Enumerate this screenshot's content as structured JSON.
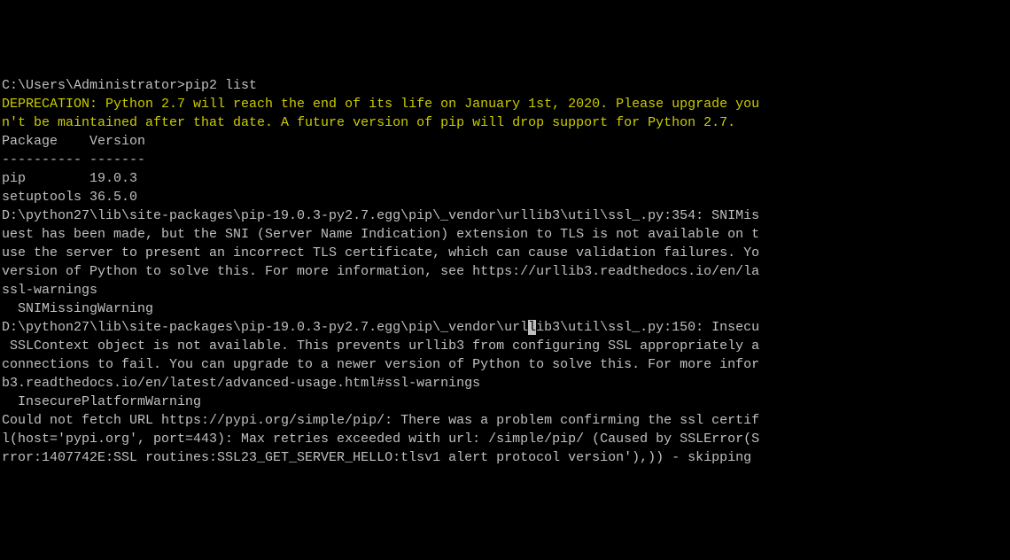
{
  "terminal": {
    "prompt": "C:\\Users\\Administrator>",
    "command": "pip2 list",
    "deprecation_line1": "DEPRECATION: Python 2.7 will reach the end of its life on January 1st, 2020. Please upgrade you",
    "deprecation_line2": "n't be maintained after that date. A future version of pip will drop support for Python 2.7.",
    "header": "Package    Version",
    "separator": "---------- -------",
    "pkg1": "pip        19.0.3",
    "pkg2": "setuptools 36.5.0",
    "warn1_line1": "D:\\python27\\lib\\site-packages\\pip-19.0.3-py2.7.egg\\pip\\_vendor\\urllib3\\util\\ssl_.py:354: SNIMis",
    "warn1_line2": "uest has been made, but the SNI (Server Name Indication) extension to TLS is not available on t",
    "warn1_line3": "use the server to present an incorrect TLS certificate, which can cause validation failures. Yo",
    "warn1_line4": "version of Python to solve this. For more information, see https://urllib3.readthedocs.io/en/la",
    "warn1_line5": "ssl-warnings",
    "warn1_line6": "  SNIMissingWarning",
    "warn2_line1_a": "D:\\python27\\lib\\site-packages\\pip-19.0.3-py2.7.egg\\pip\\_vendor\\url",
    "cursor_char": "l",
    "warn2_line1_b": "ib3\\util\\ssl_.py:150: Insecu",
    "warn2_line2": " SSLContext object is not available. This prevents urllib3 from configuring SSL appropriately a",
    "warn2_line3": "connections to fail. You can upgrade to a newer version of Python to solve this. For more infor",
    "warn2_line4": "b3.readthedocs.io/en/latest/advanced-usage.html#ssl-warnings",
    "warn2_line5": "  InsecurePlatformWarning",
    "err_line1": "Could not fetch URL https://pypi.org/simple/pip/: There was a problem confirming the ssl certif",
    "err_line2": "l(host='pypi.org', port=443): Max retries exceeded with url: /simple/pip/ (Caused by SSLError(S",
    "err_line3": "rror:1407742E:SSL routines:SSL23_GET_SERVER_HELLO:tlsv1 alert protocol version'),)) - skipping"
  }
}
